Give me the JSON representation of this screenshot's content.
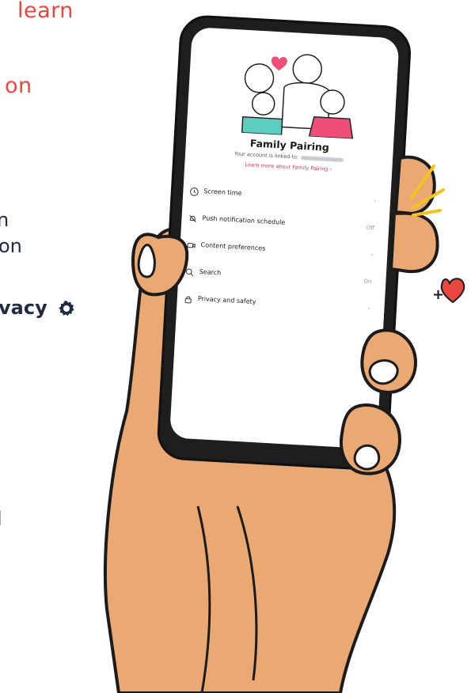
{
  "left_text": {
    "line1": "learn",
    "line2": "on",
    "line3": "n",
    "line4": "on",
    "line5": "vacy",
    "line6": "l"
  },
  "colors": {
    "accent_red": "#e8473f",
    "ink": "#1f2a44",
    "skin": "#eaa873",
    "link_pink": "#ef2f55",
    "teal": "#5ccfc1",
    "pink": "#ef4e78",
    "yellow": "#f5c21b"
  },
  "doodle_text": "+",
  "phone": {
    "title": "Family Pairing",
    "subtitle": "Your account is linked to:",
    "link": "Learn more about Family Pairing",
    "link_chevron": "›",
    "settings": [
      {
        "icon": "clock-icon",
        "label": "Screen time",
        "value": "›"
      },
      {
        "icon": "bell-off-icon",
        "label": "Push notification schedule",
        "value": "Off"
      },
      {
        "icon": "video-icon",
        "label": "Content preferences",
        "value": "›"
      },
      {
        "icon": "search-icon",
        "label": "Search",
        "value": "On"
      },
      {
        "icon": "lock-icon",
        "label": "Privacy and safety",
        "value": "›"
      }
    ]
  }
}
